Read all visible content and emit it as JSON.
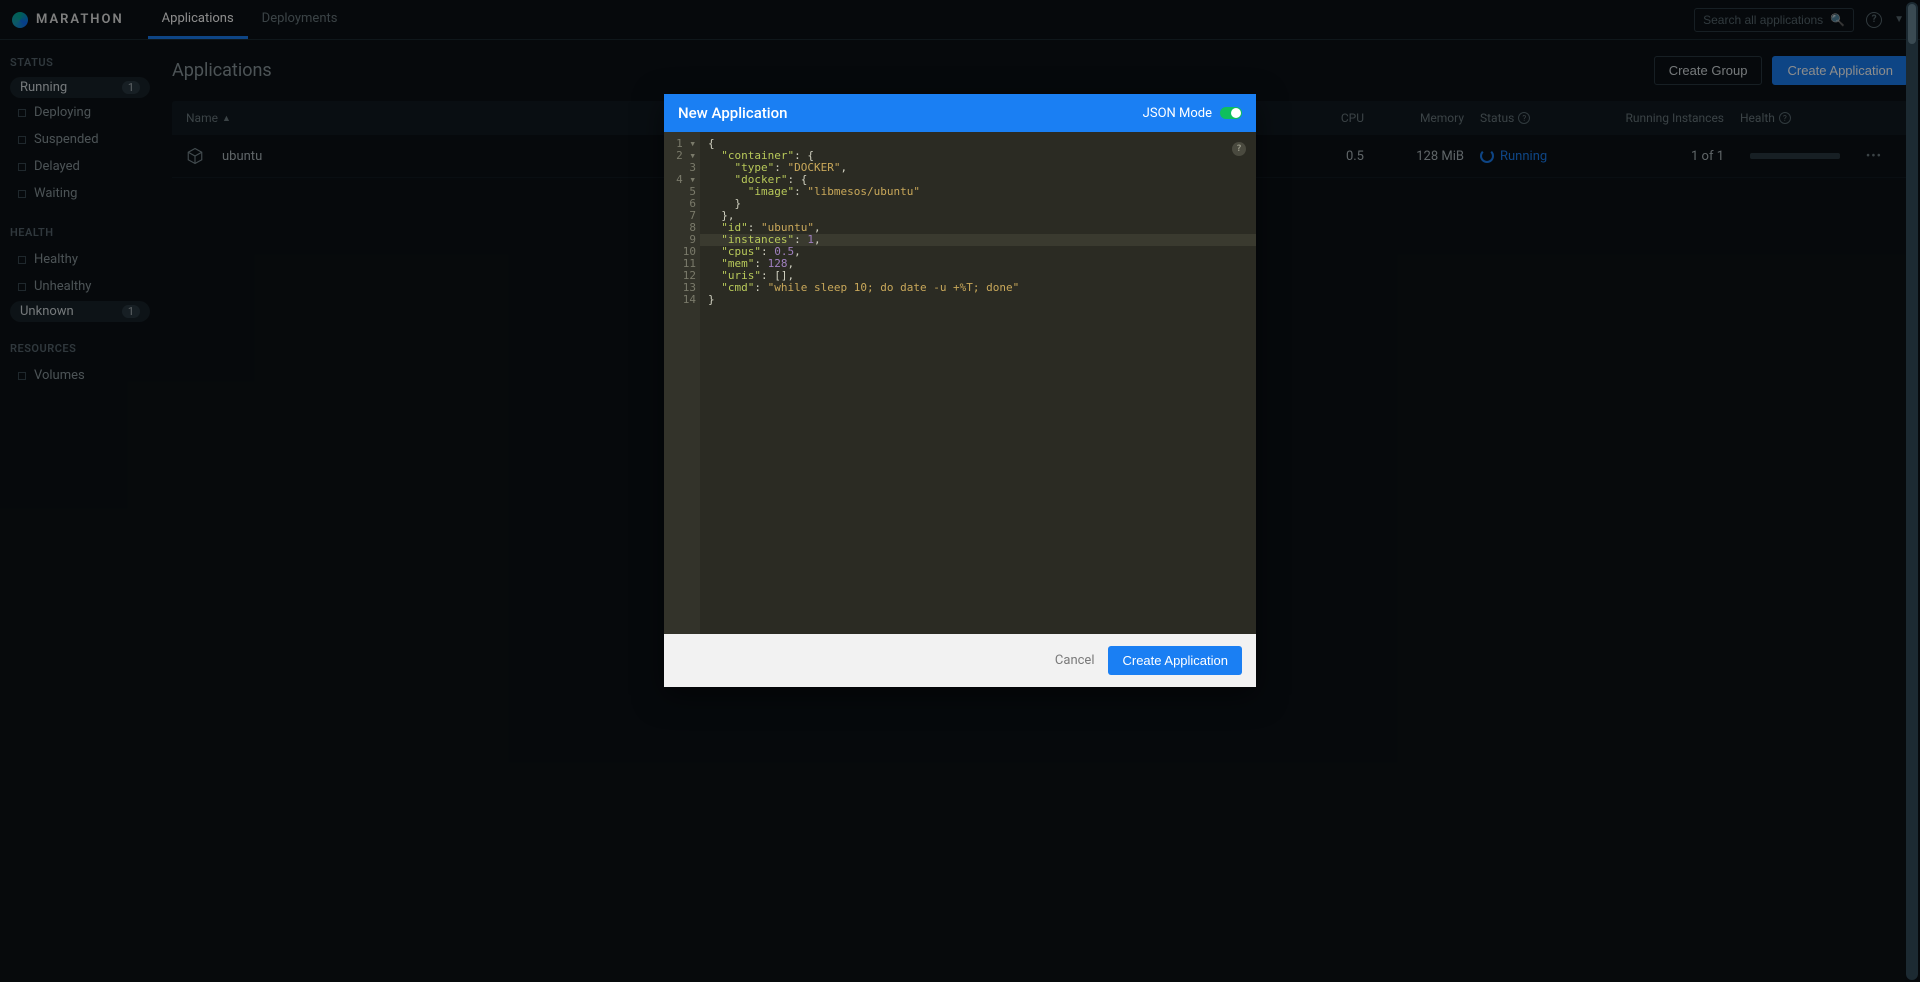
{
  "brand": "MARATHON",
  "nav": {
    "applications": "Applications",
    "deployments": "Deployments"
  },
  "search": {
    "placeholder": "Search all applications"
  },
  "sidebar": {
    "status_header": "STATUS",
    "status": [
      {
        "label": "Running",
        "count": "1"
      },
      {
        "label": "Deploying"
      },
      {
        "label": "Suspended"
      },
      {
        "label": "Delayed"
      },
      {
        "label": "Waiting"
      }
    ],
    "health_header": "HEALTH",
    "health": [
      {
        "label": "Healthy"
      },
      {
        "label": "Unhealthy"
      },
      {
        "label": "Unknown",
        "count": "1"
      }
    ],
    "resources_header": "RESOURCES",
    "resources": [
      {
        "label": "Volumes"
      }
    ]
  },
  "page": {
    "title": "Applications",
    "create_group": "Create Group",
    "create_app": "Create Application"
  },
  "table": {
    "cols": {
      "name": "Name",
      "cpu": "CPU",
      "memory": "Memory",
      "status": "Status",
      "instances": "Running Instances",
      "health": "Health"
    },
    "rows": [
      {
        "name": "ubuntu",
        "cpu": "0.5",
        "memory": "128 MiB",
        "status": "Running",
        "instances": "1 of 1"
      }
    ]
  },
  "modal": {
    "title": "New Application",
    "json_mode_label": "JSON Mode",
    "cancel": "Cancel",
    "create": "Create Application",
    "code": {
      "container": "container",
      "type_key": "type",
      "type_val": "DOCKER",
      "docker": "docker",
      "image_key": "image",
      "image_val": "libmesos/ubuntu",
      "id_key": "id",
      "id_val": "ubuntu",
      "instances_key": "instances",
      "instances_val": "1",
      "cpus_key": "cpus",
      "cpus_val": "0.5",
      "mem_key": "mem",
      "mem_val": "128",
      "uris_key": "uris",
      "cmd_key": "cmd",
      "cmd_val": "while sleep 10; do date -u +%T; done"
    },
    "line_numbers": [
      "1",
      "2",
      "3",
      "4",
      "5",
      "6",
      "7",
      "8",
      "9",
      "10",
      "11",
      "12",
      "13",
      "14"
    ]
  }
}
